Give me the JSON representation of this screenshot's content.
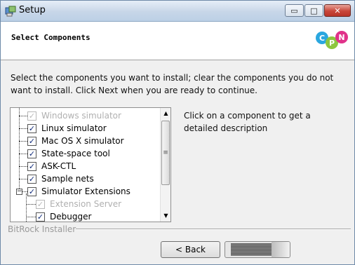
{
  "window": {
    "title": "Setup",
    "controls": {
      "minimize": "▭",
      "maximize": "□",
      "close": "✕"
    }
  },
  "header": {
    "title": "Select Components",
    "logo_letters": [
      "C",
      "P",
      "N"
    ],
    "logo_colors": [
      "#2aa7df",
      "#8dc63f",
      "#e0328a"
    ]
  },
  "intro": "Select the components you want to install; clear the components you do not want to install. Click Next when you are ready to continue.",
  "components": [
    {
      "label": "Windows simulator",
      "checked": true,
      "disabled": true
    },
    {
      "label": "Linux simulator",
      "checked": true,
      "disabled": false
    },
    {
      "label": "Mac OS X simulator",
      "checked": true,
      "disabled": false
    },
    {
      "label": "State-space tool",
      "checked": true,
      "disabled": false
    },
    {
      "label": "ASK-CTL",
      "checked": true,
      "disabled": false
    },
    {
      "label": "Sample nets",
      "checked": true,
      "disabled": false
    },
    {
      "label": "Simulator Extensions",
      "checked": true,
      "disabled": false,
      "expander": "−"
    },
    {
      "label": "Extension Server",
      "checked": true,
      "disabled": true
    },
    {
      "label": "Debugger",
      "checked": true,
      "disabled": false
    }
  ],
  "scrollbar": {
    "up": "▲",
    "down": "▼",
    "grip": "≡"
  },
  "description": "Click on a component to get a detailed description",
  "footer": {
    "brand": "BitRock Installer"
  },
  "buttons": {
    "back": "< Back"
  },
  "check_glyph": "✓"
}
